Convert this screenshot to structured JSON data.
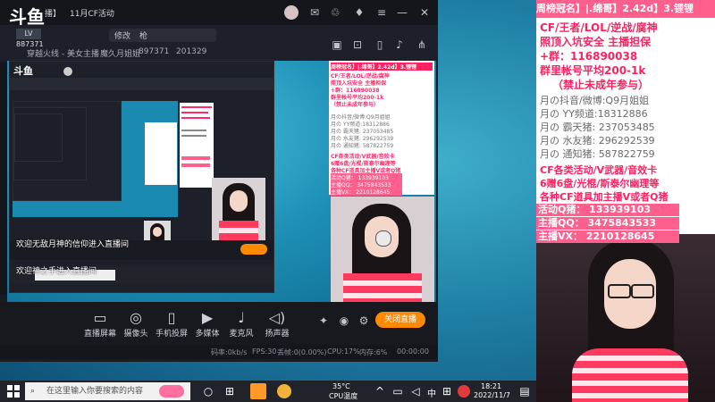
{
  "app": {
    "logo": "斗鱼",
    "header_title_prefix": "播】",
    "header_title": "11月CF活动",
    "edit_label": "修改",
    "category_value": "枪",
    "user_badge": "887371",
    "streamer_line": "穿越火线 - 美女主播",
    "weekly_label": "魔久月姐姐",
    "room_id": "897371",
    "fans_count": "201329"
  },
  "chat": {
    "line1": "欢迎无敌月神的信仰进入直播间",
    "line2": "欢迎神之手进入直播间"
  },
  "toolbar": {
    "items": [
      {
        "label": "直播屏幕",
        "icon": "screen-icon"
      },
      {
        "label": "摄像头",
        "icon": "camera-icon"
      },
      {
        "label": "手机投屏",
        "icon": "phone-icon"
      },
      {
        "label": "多媒体",
        "icon": "media-icon"
      },
      {
        "label": "麦克风",
        "icon": "mic-icon"
      },
      {
        "label": "扬声器",
        "icon": "speaker-icon"
      }
    ],
    "start_label": "关闭直播"
  },
  "status": {
    "bitrate": "码率:0kb/s",
    "fps": "FPS:30",
    "drop": "丢帧:0(0.00%)",
    "cpu": "CPU:17%",
    "mem": "内存:6%",
    "time": "00:00:00"
  },
  "taskbar": {
    "search_placeholder": "在这里输入你要搜索的内容",
    "temp": "35°C",
    "temp_label": "CPU温度",
    "lang": "中",
    "clock_time": "18:21",
    "clock_date": "2022/11/7"
  },
  "overlay": {
    "title": "周榜冠名】|.绵哥】2.42d】3.锂锂",
    "line1": "CF/王者/LOL/逆战/腐神",
    "line2": "照顶入坑安全 主播担保",
    "line3": "+群：116890038",
    "line4": "群里帐号平均200-1k",
    "line5": "（禁止未成年参与）",
    "douyin": "月の抖音/微博:Q9月姐姐",
    "yy": "月の YY频道:18312886",
    "tiktok": "月の 霸天猪:  237053485",
    "shuiyou": "月の 水友猪:  296292539",
    "tongzhi": "月の 通知猪:  587822759",
    "promo1": "CF各类活动/V武器/音效卡",
    "promo2": "6赠6盘/光棍/斯泰尔幽理等",
    "promo3": "各种CF道具加主播V或者Q猪",
    "activity_q": "活动Q猪：  133939103",
    "anchor_qq": "主播QQ：  3475843533",
    "anchor_vx": "主播VX：  2210128645"
  },
  "colors": {
    "accent": "#ff8a00",
    "overlay_pink": "#ff2060",
    "overlay_pink_bg": "#ff5f8d"
  }
}
